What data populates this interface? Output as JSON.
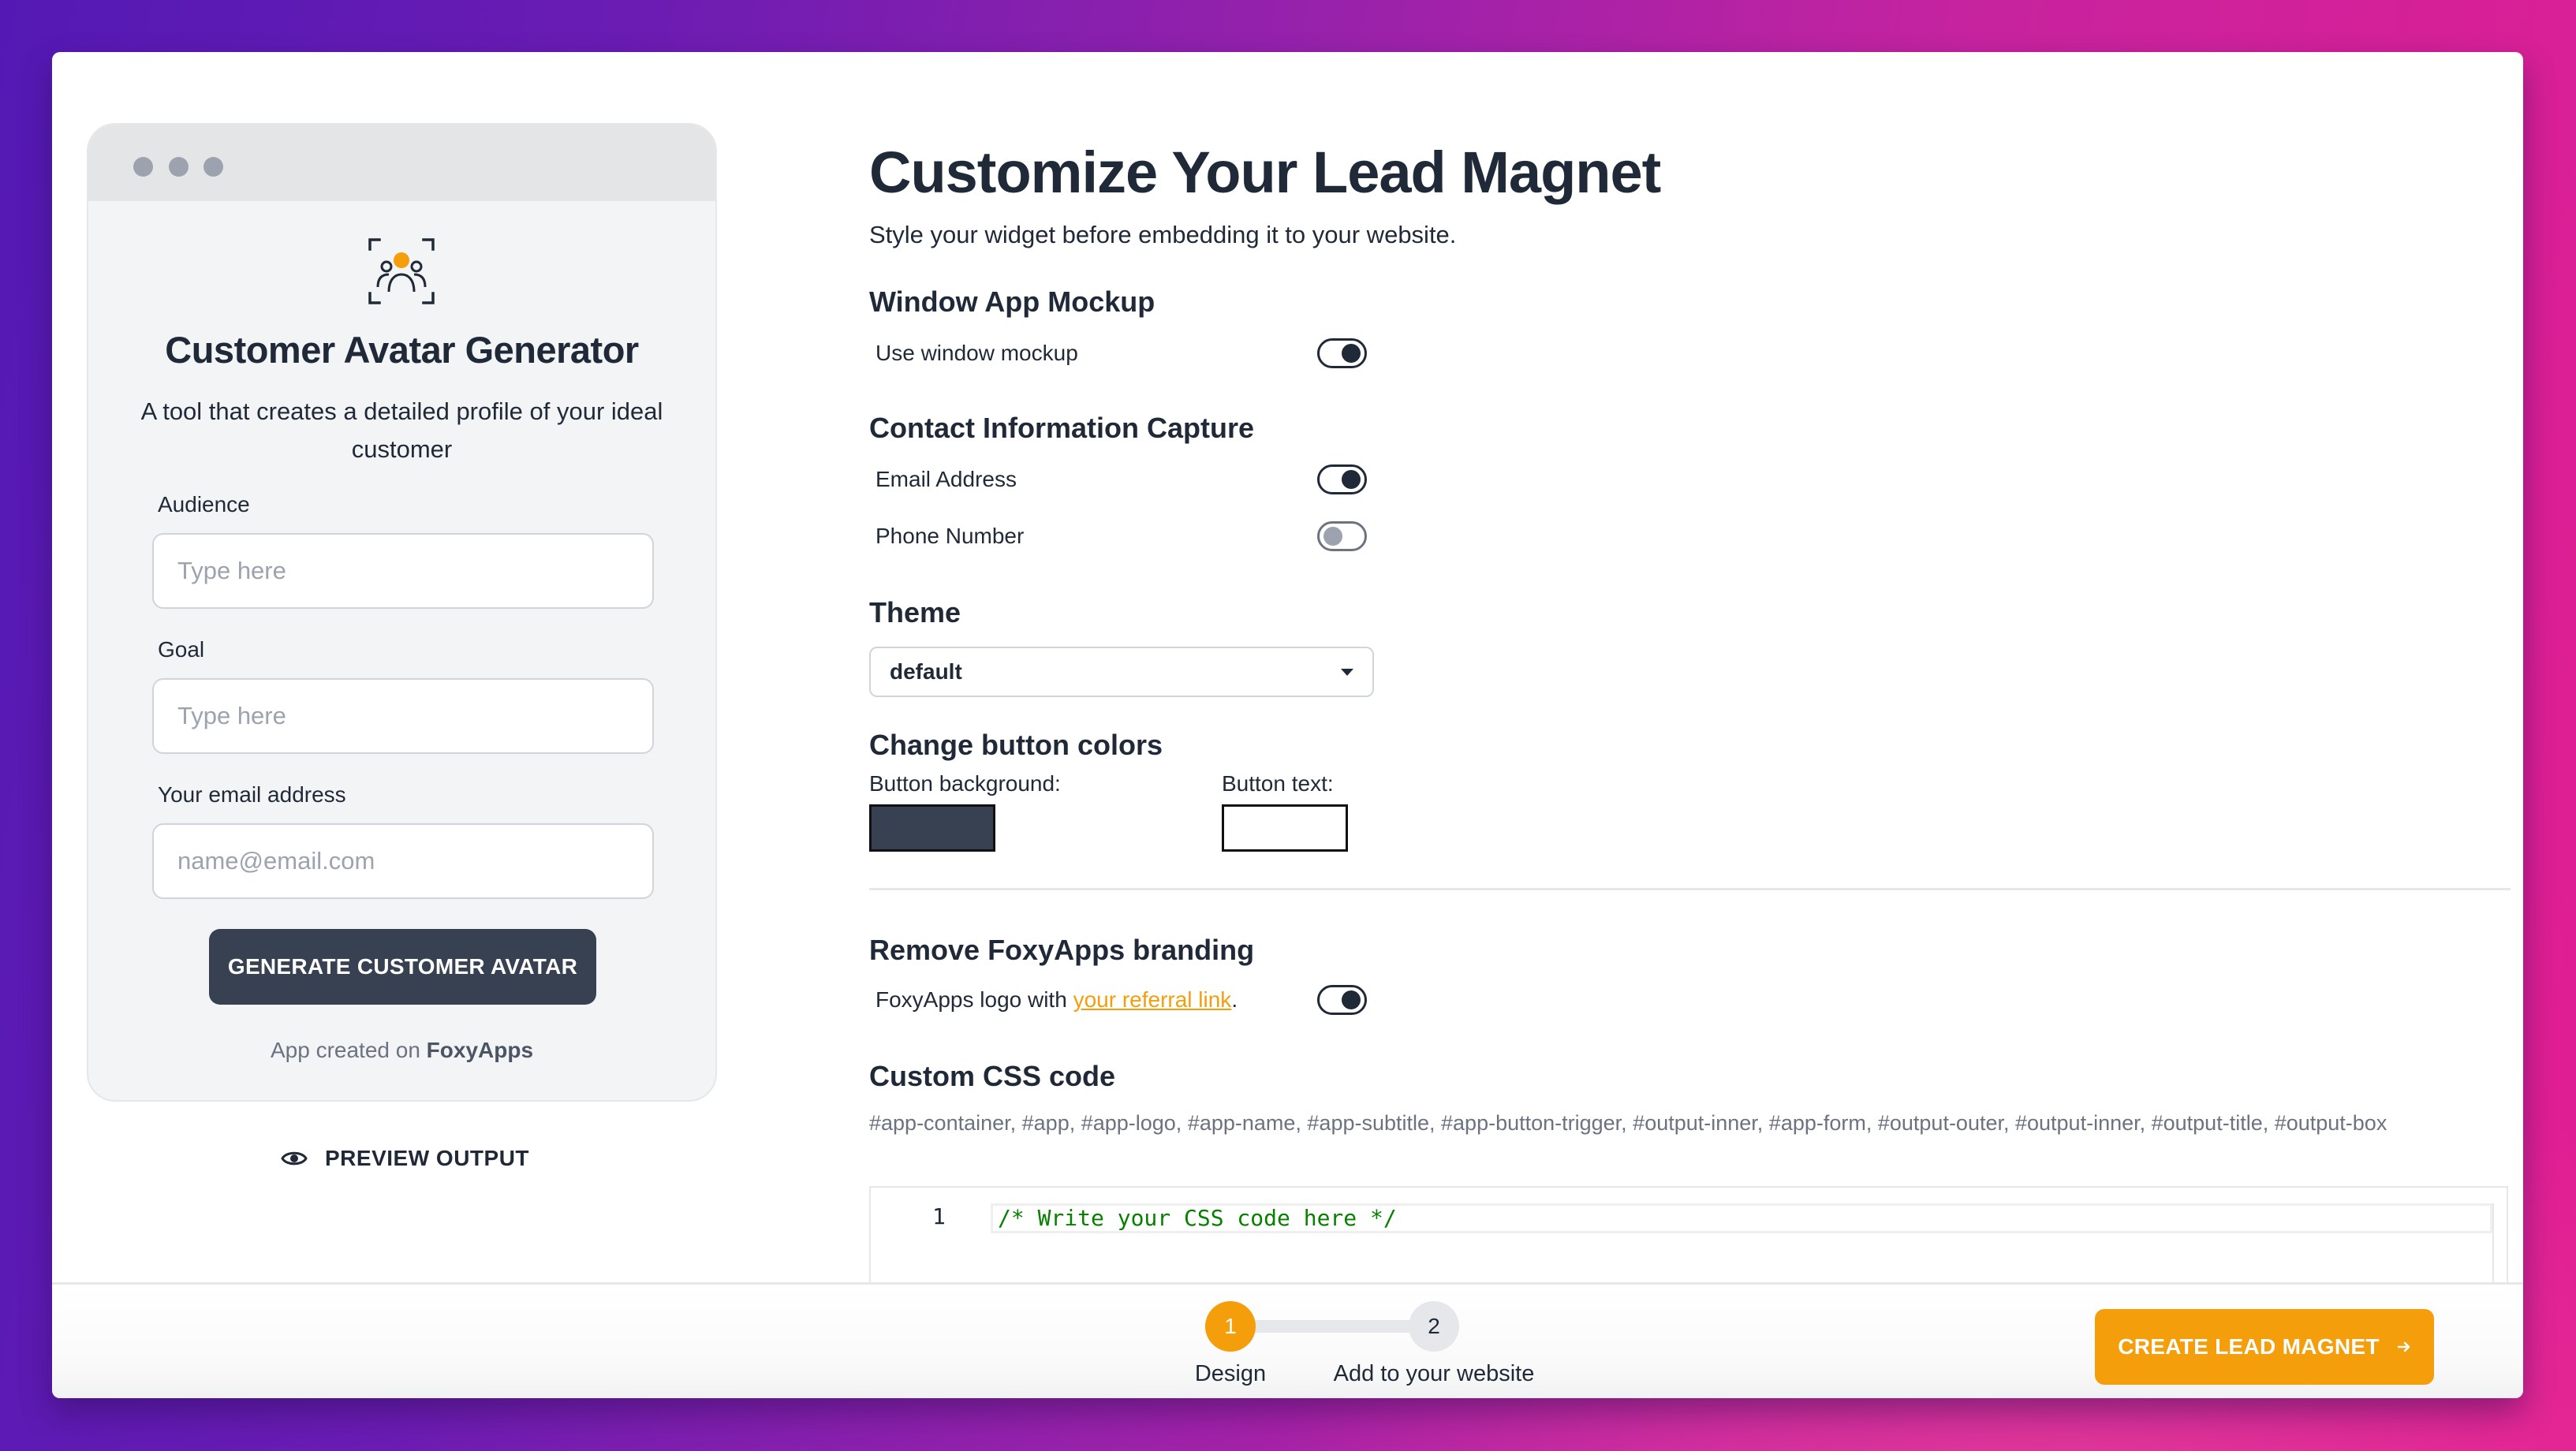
{
  "mockup": {
    "app_icon": "customer-group-focus-icon",
    "title": "Customer Avatar Generator",
    "subtitle": "A tool that creates a detailed profile of your ideal customer",
    "fields": [
      {
        "label": "Audience",
        "placeholder": "Type here",
        "value": ""
      },
      {
        "label": "Goal",
        "placeholder": "Type here",
        "value": ""
      },
      {
        "label": "Your email address",
        "placeholder": "name@email.com",
        "value": ""
      }
    ],
    "button_label": "GENERATE CUSTOMER AVATAR",
    "credit_prefix": "App created on",
    "credit_brand": "FoxyApps"
  },
  "preview": {
    "icon": "eye-icon",
    "label": "PREVIEW OUTPUT"
  },
  "settings": {
    "title": "Customize Your Lead Magnet",
    "subtitle": "Style your widget before embedding it to your website.",
    "window_mockup": {
      "heading": "Window App Mockup",
      "options": [
        {
          "label": "Use window mockup",
          "enabled": true
        }
      ]
    },
    "contact_capture": {
      "heading": "Contact Information Capture",
      "options": [
        {
          "label": "Email Address",
          "enabled": true
        },
        {
          "label": "Phone Number",
          "enabled": false
        }
      ]
    },
    "theme": {
      "heading": "Theme",
      "selected": "default"
    },
    "button_colors": {
      "heading": "Change button colors",
      "background_label": "Button background:",
      "background_color": "#374151",
      "text_label": "Button text:",
      "text_color": "#ffffff"
    },
    "branding": {
      "heading": "Remove FoxyApps branding",
      "label_prefix": "FoxyApps logo with",
      "link_text": "your referral link",
      "label_suffix": ".",
      "enabled": true
    },
    "custom_css": {
      "heading": "Custom CSS code",
      "selectors": "#app-container, #app, #app-logo, #app-name, #app-subtitle, #app-button-trigger, #output-inner, #app-form, #output-outer, #output-inner, #output-title, #output-box",
      "line_number": "1",
      "code": "/* Write your CSS code here */"
    }
  },
  "stepper": {
    "current_step": 1,
    "steps": [
      {
        "number": "1",
        "label": "Design"
      },
      {
        "number": "2",
        "label": "Add to your website"
      }
    ]
  },
  "cta": {
    "label": "CREATE LEAD MAGNET",
    "icon": "arrow-right-icon"
  },
  "colors": {
    "accent": "#f59e0b",
    "dark": "#1f2937",
    "button_dark": "#374151"
  }
}
